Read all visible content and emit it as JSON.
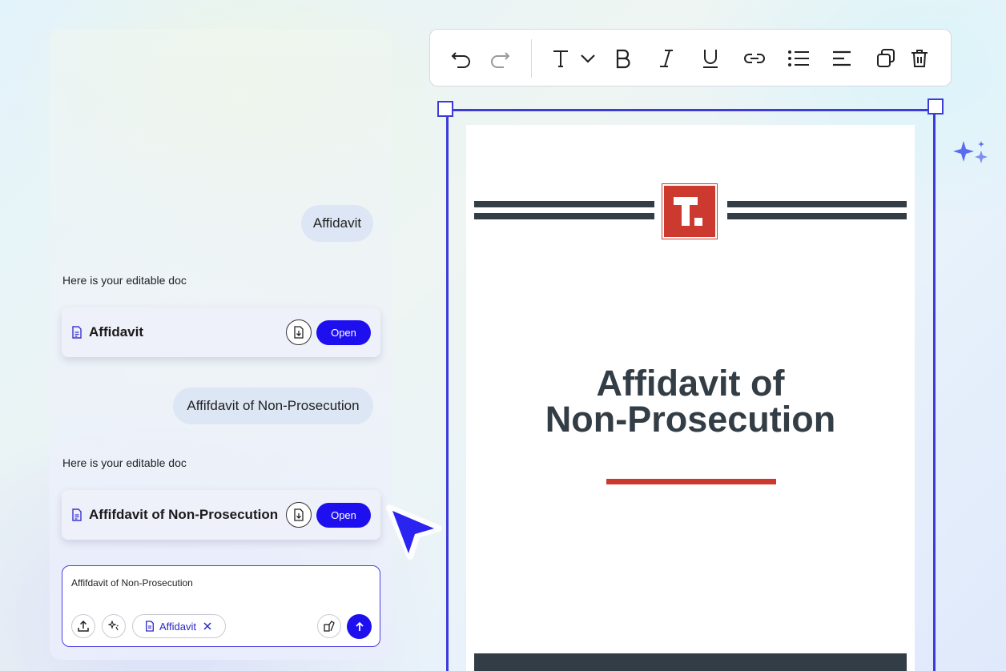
{
  "chat": {
    "messages": [
      {
        "role": "user",
        "text": "Affidavit"
      },
      {
        "role": "assistant",
        "text": "Here is your editable doc",
        "card": {
          "title": "Affidavit",
          "open_label": "Open"
        }
      },
      {
        "role": "user",
        "text": "Affifdavit of Non-Prosecution"
      },
      {
        "role": "assistant",
        "text": "Here is your editable doc",
        "card": {
          "title": "Affifdavit of Non-Prosecution",
          "open_label": "Open"
        }
      }
    ],
    "input": {
      "value": "Affifdavit of Non-Prosecution",
      "attachment_chip": "Affidavit"
    }
  },
  "toolbar": {
    "tools": [
      "undo-icon",
      "redo-icon",
      "text-style-icon",
      "chevron-down-icon",
      "bold-icon",
      "italic-icon",
      "underline-icon",
      "link-icon",
      "bulleted-list-icon",
      "align-left-icon",
      "duplicate-icon",
      "delete-icon"
    ]
  },
  "document": {
    "logo_letter": "T.",
    "title_line1": "Affidavit of",
    "title_line2": "Non-Prosecution"
  },
  "colors": {
    "accent": "#1e10ee",
    "selection": "#3d3bd9",
    "brand_red": "#cc3a2f",
    "doc_dark": "#333d45"
  }
}
